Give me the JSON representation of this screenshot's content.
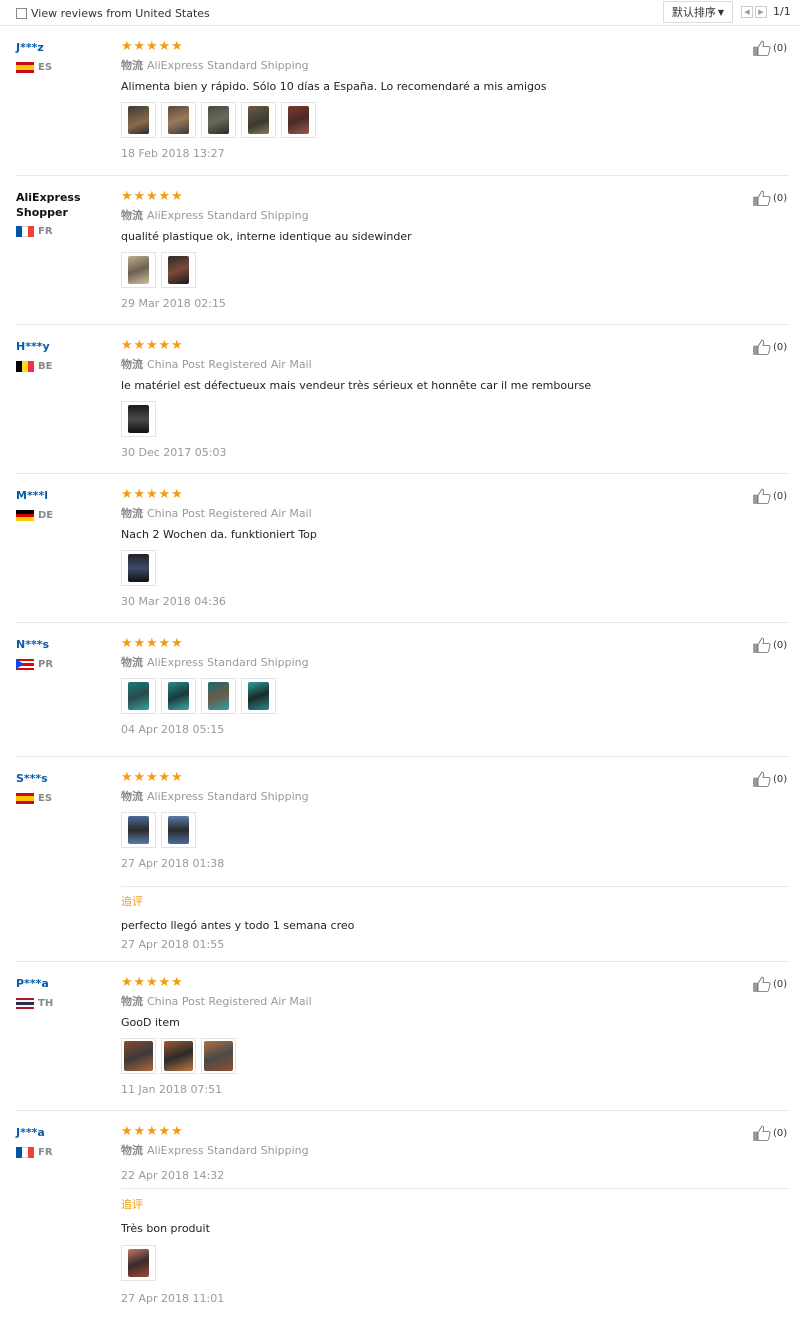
{
  "header": {
    "filter_label": "View reviews from United States",
    "sort_label": "默认排序",
    "page": "1/1"
  },
  "reviews": [
    {
      "user": "J***z",
      "country": "ES",
      "shipping_prefix": "物流",
      "shipping": "AliExpress Standard Shipping",
      "text": "Alimenta bien y rápido. Sólo 10 días a España. Lo recomendaré a mis amigos",
      "date": "18 Feb 2018 13:27",
      "likes": "(0)",
      "rating": 5,
      "photos": 5
    },
    {
      "user": "AliExpress Shopper",
      "country": "FR",
      "shipping_prefix": "物流",
      "shipping": "AliExpress Standard Shipping",
      "text": "qualité plastique ok, interne identique au sidewinder",
      "date": "29 Mar 2018 02:15",
      "likes": "(0)",
      "rating": 5,
      "photos": 2
    },
    {
      "user": "H***y",
      "country": "BE",
      "shipping_prefix": "物流",
      "shipping": "China Post Registered Air Mail",
      "text": "le matériel est défectueux mais vendeur très sérieux et honnête car il me rembourse",
      "date": "30 Dec 2017 05:03",
      "likes": "(0)",
      "rating": 5,
      "photos": 1
    },
    {
      "user": "M***l",
      "country": "DE",
      "shipping_prefix": "物流",
      "shipping": "China Post Registered Air Mail",
      "text": "Nach 2 Wochen da. funktioniert Top",
      "date": "30 Mar 2018 04:36",
      "likes": "(0)",
      "rating": 5,
      "photos": 1
    },
    {
      "user": "N***s",
      "country": "PR",
      "shipping_prefix": "物流",
      "shipping": "AliExpress Standard Shipping",
      "text": "",
      "date": "04 Apr 2018 05:15",
      "likes": "(0)",
      "rating": 5,
      "photos": 4
    },
    {
      "user": "S***s",
      "country": "ES",
      "shipping_prefix": "物流",
      "shipping": "AliExpress Standard Shipping",
      "text": "",
      "date": "27 Apr 2018 01:38",
      "likes": "(0)",
      "rating": 5,
      "photos": 2,
      "followup": {
        "label": "追评",
        "text": "perfecto llegó antes y todo 1 semana creo",
        "date": "27 Apr 2018 01:55"
      }
    },
    {
      "user": "P***a",
      "country": "TH",
      "shipping_prefix": "物流",
      "shipping": "China Post Registered Air Mail",
      "text": "GooD item",
      "date": "11 Jan 2018 07:51",
      "likes": "(0)",
      "rating": 5,
      "photos": 3
    },
    {
      "user": "J***a",
      "country": "FR",
      "shipping_prefix": "物流",
      "shipping": "AliExpress Standard Shipping",
      "text": "",
      "date": "22 Apr 2018 14:32",
      "likes": "(0)",
      "rating": 5,
      "photos": 0,
      "followup": {
        "label": "追评",
        "text": "Très bon produit",
        "date": "27 Apr 2018 11:01",
        "photos": 1
      }
    }
  ],
  "colors": {
    "star": "#f39c12",
    "username": "#0c5ba8",
    "followup_label": "#f39c12"
  }
}
